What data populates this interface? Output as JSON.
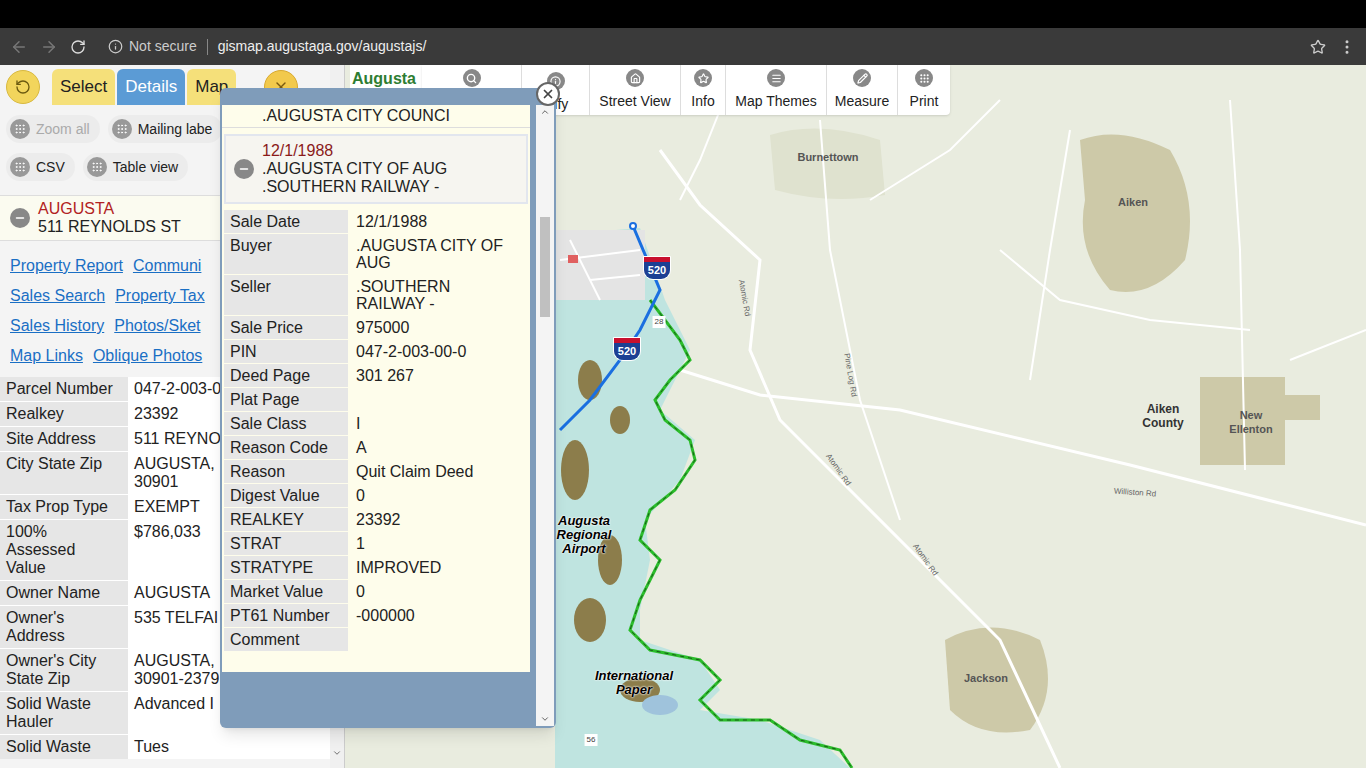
{
  "browser": {
    "security": "Not secure",
    "url": "gismap.augustaga.gov/augustajs/"
  },
  "panel": {
    "tabs": [
      {
        "label": "Select",
        "selected": false
      },
      {
        "label": "Details",
        "selected": true
      },
      {
        "label": "Map",
        "selected": false
      }
    ],
    "tools": [
      {
        "label": "Zoom all",
        "disabled": true
      },
      {
        "label": "Mailing labe",
        "disabled": false
      }
    ],
    "tools2": [
      {
        "label": "CSV",
        "disabled": false
      },
      {
        "label": "Table view",
        "disabled": false
      }
    ],
    "record": {
      "city": "AUGUSTA",
      "address": "511 REYNOLDS ST",
      "expanded": true
    },
    "links": [
      [
        "Property Report",
        "Communi"
      ],
      [
        "Sales Search",
        "Property Tax"
      ],
      [
        "Sales History",
        "Photos/Sket"
      ],
      [
        "Map Links",
        "Oblique Photos"
      ]
    ],
    "fields": [
      {
        "label": [
          "Parcel Number"
        ],
        "value": [
          "047-2-003-0"
        ]
      },
      {
        "label": [
          "Realkey"
        ],
        "value": [
          "23392"
        ]
      },
      {
        "label": [
          "Site Address"
        ],
        "value": [
          "511 REYNO"
        ]
      },
      {
        "label": [
          "City State Zip"
        ],
        "value": [
          "AUGUSTA,",
          "30901"
        ]
      },
      {
        "label": [
          "Tax Prop Type"
        ],
        "value": [
          "EXEMPT"
        ]
      },
      {
        "label": [
          "100%",
          "Assessed",
          "Value"
        ],
        "value": [
          "$786,033"
        ]
      },
      {
        "label": [
          "Owner Name"
        ],
        "value": [
          "AUGUSTA"
        ]
      },
      {
        "label": [
          "Owner's",
          "Address"
        ],
        "value": [
          "535 TELFAI"
        ]
      },
      {
        "label": [
          "Owner's City",
          "State Zip"
        ],
        "value": [
          "AUGUSTA,",
          "30901-2379"
        ]
      },
      {
        "label": [
          "Solid Waste",
          "Hauler"
        ],
        "value": [
          "Advanced I"
        ]
      },
      {
        "label": [
          "Solid Waste"
        ],
        "value": [
          "Tues"
        ]
      }
    ]
  },
  "brand": "Augusta",
  "toolbar": [
    {
      "label": "ntify"
    },
    {
      "label": "Street View"
    },
    {
      "label": "Info"
    },
    {
      "label": "Map Themes"
    },
    {
      "label": "Measure"
    },
    {
      "label": "Print"
    }
  ],
  "popup": {
    "sales": [
      {
        "date": "",
        "lines": [
          ".AUGUSTA CITY COUNCI"
        ],
        "selected": false,
        "expanded": false
      },
      {
        "date": "12/1/1988",
        "lines": [
          ".AUGUSTA CITY OF AUG",
          ".SOUTHERN RAILWAY -"
        ],
        "selected": true,
        "expanded": true
      }
    ],
    "details": [
      {
        "label": "Sale Date",
        "value": [
          "12/1/1988"
        ]
      },
      {
        "label": "Buyer",
        "value": [
          ".AUGUSTA CITY OF",
          "AUG"
        ]
      },
      {
        "label": "Seller",
        "value": [
          ".SOUTHERN",
          "RAILWAY -"
        ]
      },
      {
        "label": "Sale Price",
        "value": [
          "975000"
        ]
      },
      {
        "label": "PIN",
        "value": [
          "047-2-003-00-0"
        ]
      },
      {
        "label": "Deed Page",
        "value": [
          "301 267"
        ]
      },
      {
        "label": "Plat Page",
        "value": [
          ""
        ]
      },
      {
        "label": "Sale Class",
        "value": [
          "I"
        ]
      },
      {
        "label": "Reason Code",
        "value": [
          "A"
        ]
      },
      {
        "label": "Reason",
        "value": [
          "Quit Claim Deed"
        ]
      },
      {
        "label": "Digest Value",
        "value": [
          "0"
        ]
      },
      {
        "label": "REALKEY",
        "value": [
          "23392"
        ]
      },
      {
        "label": "STRAT",
        "value": [
          "1"
        ]
      },
      {
        "label": "STRATYPE",
        "value": [
          "IMPROVED"
        ]
      },
      {
        "label": "Market Value",
        "value": [
          "0"
        ]
      },
      {
        "label": "PT61 Number",
        "value": [
          "-000000"
        ]
      },
      {
        "label": "Comment",
        "value": [
          ""
        ]
      }
    ]
  },
  "map": {
    "places": [
      {
        "lines": [
          "Burnettown"
        ],
        "kind": "town"
      },
      {
        "lines": [
          "Aiken"
        ],
        "kind": "town"
      },
      {
        "lines": [
          "Aiken",
          "County"
        ],
        "kind": "county"
      },
      {
        "lines": [
          "New",
          "Ellenton"
        ],
        "kind": "town"
      },
      {
        "lines": [
          "Augusta",
          "Regional",
          "Airport"
        ],
        "kind": "landmark"
      },
      {
        "lines": [
          "International",
          "Paper"
        ],
        "kind": "landmark"
      },
      {
        "lines": [
          "Jackson"
        ],
        "kind": "town"
      }
    ],
    "roads": [
      "Atomic Rd",
      "Atomic Rd",
      "Atomic Rd",
      "Pine Log Rd",
      "Williston Rd"
    ],
    "routes": [
      "28",
      "56"
    ],
    "shields": [
      "520",
      "520"
    ]
  }
}
